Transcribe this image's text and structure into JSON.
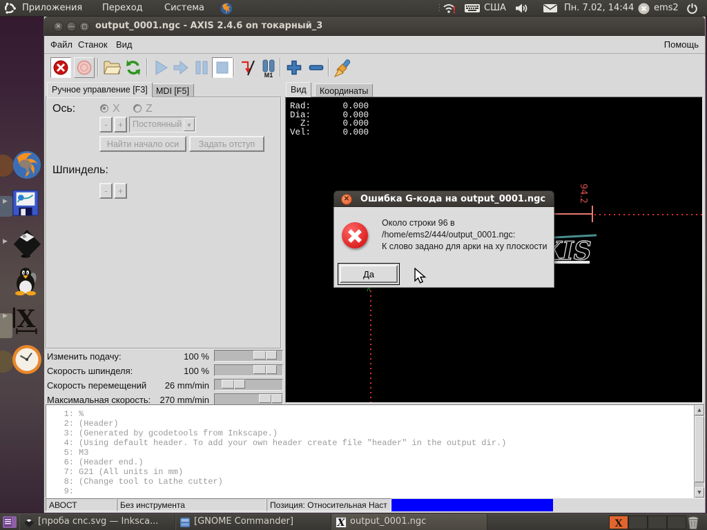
{
  "colors": {
    "panel_bg": "#3a3834",
    "selection_blue": "#0000fe",
    "error_red": "#d40606",
    "workspace_active": "#e0652f"
  },
  "panel": {
    "menus": [
      "Приложения",
      "Переход",
      "Система"
    ],
    "keyboard_layout": "США",
    "clock": "Пн. 7.02, 14:44",
    "username": "ems2"
  },
  "window": {
    "title": "output_0001.ngc - AXIS 2.4.6 on токарный_3",
    "menus": [
      "Файл",
      "Станок",
      "Вид"
    ],
    "menu_right": "Помощь"
  },
  "toolbar": {
    "icons": [
      "estop",
      "machine-power",
      "open-file",
      "reload",
      "run",
      "run-from-line",
      "pause",
      "stop",
      "skip-line",
      "optional-pause",
      "zoom-in",
      "zoom-out",
      "clear-plot"
    ]
  },
  "left_panel": {
    "tabs": [
      "Ручное управление [F3]",
      "MDI [F5]"
    ],
    "axis_label": "Ось:",
    "axis_x": "X",
    "axis_z": "Z",
    "jog_minus": "-",
    "jog_plus": "+",
    "jog_mode": "Постоянный",
    "home_button": "Найти начало оси",
    "offset_button": "Задать отступ",
    "spindle_label": "Шпиндель:",
    "spindle_minus": "-",
    "spindle_plus": "+",
    "sliders": [
      {
        "label": "Изменить подачу:",
        "value": "100 %"
      },
      {
        "label": "Скорость шпинделя:",
        "value": "100 %"
      },
      {
        "label": "Скорость перемещений",
        "value": "26 mm/min"
      },
      {
        "label": "Максимальная скорость:",
        "value": "270 mm/min"
      }
    ]
  },
  "right_panel": {
    "tabs": [
      "Вид",
      "Координаты"
    ],
    "dro": [
      {
        "label": "Rad:",
        "value": "0.000"
      },
      {
        "label": "Dia:",
        "value": "0.000"
      },
      {
        "label": "Z:",
        "value": "0.000"
      },
      {
        "label": "Vel:",
        "value": "0.000"
      }
    ],
    "dimension_label": "94.2",
    "logo_text": "AXIS"
  },
  "dialog": {
    "title": "Ошибка G-кода на output_0001.ngc",
    "lines": [
      "Около строки 96 в",
      "/home/ems2/444/output_0001.ngc:",
      "К слово задано для арки на ху плоскости"
    ],
    "ok_button": "Да"
  },
  "gcode": {
    "lines": [
      {
        "num": "1:",
        "text": "%"
      },
      {
        "num": "2:",
        "text": "(Header)"
      },
      {
        "num": "3:",
        "text": "(Generated by gcodetools from Inkscape.)"
      },
      {
        "num": "4:",
        "text": "(Using default header. To add your own header create file \"header\" in the output dir.)"
      },
      {
        "num": "5:",
        "text": "M3"
      },
      {
        "num": "6:",
        "text": "(Header end.)"
      },
      {
        "num": "7:",
        "text": "G21 (All units in mm)"
      },
      {
        "num": "8:",
        "text": "(Change tool to Lathe cutter)"
      },
      {
        "num": "9:",
        "text": ""
      }
    ]
  },
  "statusbar": {
    "estop": "АВОСТ",
    "tool": "Без инструмента",
    "position": "Позиция: Относительная Наст"
  },
  "taskbar": {
    "tasks": [
      {
        "label": "[проба cnc.svg — Inksca...",
        "icon": "inkscape"
      },
      {
        "label": "[GNOME Commander]",
        "icon": "gnome-commander"
      },
      {
        "label": "output_0001.ngc",
        "icon": "axis"
      }
    ]
  },
  "dock": {
    "icons": [
      "firefox",
      "floppy-cad",
      "inkscape",
      "tux",
      "latex-x",
      "clock"
    ]
  }
}
